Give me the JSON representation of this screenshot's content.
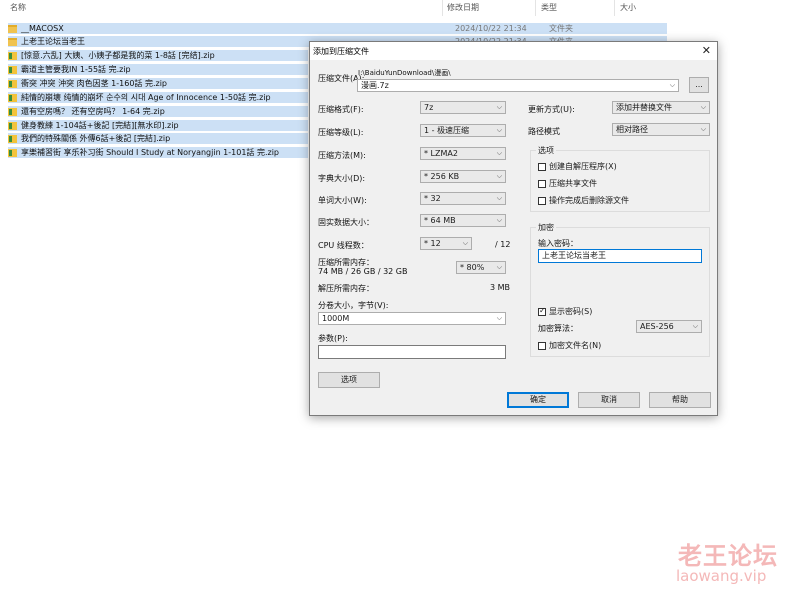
{
  "explorer": {
    "columns": {
      "name": "名称",
      "modified": "修改日期",
      "type": "类型",
      "size": "大小"
    },
    "rows": [
      {
        "name": "__MACOSX",
        "date": "2024/10/22 21:34",
        "type": "文件夹",
        "icon": "folder"
      },
      {
        "name": "上老王论坛当老王",
        "date": "2024/10/22 21:34",
        "type": "文件夹",
        "icon": "folder"
      },
      {
        "name": "[惊意.六乱] 大姨、小姨子都是我的菜 1-8話 [完结].zip",
        "icon": "zip"
      },
      {
        "name": "霸道主管要我IN 1-55話 完.zip",
        "icon": "zip"
      },
      {
        "name": "衝突 冲突 沖突 肉色因茎 1-160話 完.zip",
        "icon": "zip"
      },
      {
        "name": "純情的崩壊 纯情的崩坏 순수의 시대 Age of Innocence 1-50話 完.zip",
        "icon": "zip"
      },
      {
        "name": "還有空房嗎？ 还有空房吗？ 1-64 完.zip",
        "icon": "zip"
      },
      {
        "name": "健身教練 1-104話+後記 [完結][無水印].zip",
        "icon": "zip"
      },
      {
        "name": "我們的特殊關係 外傳6話+後記 [完結].zip",
        "icon": "zip"
      },
      {
        "name": "享樂補習街 享乐补习街 Should I Study at Noryangjin 1-101話 完.zip",
        "icon": "zip"
      }
    ]
  },
  "dialog": {
    "title": "添加到压缩文件",
    "close": "✕",
    "archive_label": "压缩文件(A):",
    "archive_path": "I:\\BaiduYunDownload\\漫画\\",
    "archive_name": "漫画.7z",
    "browse": "...",
    "format_label": "压缩格式(F):",
    "format_value": "7z",
    "level_label": "压缩等级(L):",
    "level_value": "1 - 极速压缩",
    "method_label": "压缩方法(M):",
    "method_value": "* LZMA2",
    "dict_label": "字典大小(D):",
    "dict_value": "* 256 KB",
    "word_label": "单词大小(W):",
    "word_value": "* 32",
    "solid_label": "固实数据大小：",
    "solid_value": "* 64 MB",
    "cpu_label": "CPU 线程数：",
    "cpu_value": "* 12",
    "cpu_max": "/ 12",
    "memc_label": "压缩所需内存：",
    "memc_detail": "74 MB / 26 GB / 32 GB",
    "memc_percent": "* 80%",
    "memd_label": "解压所需内存：",
    "memd_value": "3 MB",
    "split_label": "分卷大小，字节(V):",
    "split_value": "1000M",
    "params_label": "参数(P):",
    "params_value": "",
    "options_button": "选项",
    "update_label": "更新方式(U):",
    "update_value": "添加并替换文件",
    "path_label": "路径模式",
    "path_value": "相对路径",
    "options_group": "选项",
    "opt_sfx": "创建自解压程序(X)",
    "opt_shared": "压缩共享文件",
    "opt_delete": "操作完成后删除源文件",
    "enc_group": "加密",
    "enc_pwd_label": "输入密码：",
    "enc_pwd_value": "上老王论坛当老王",
    "enc_show": "显示密码(S)",
    "enc_method_label": "加密算法：",
    "enc_method_value": "AES-256",
    "enc_names": "加密文件名(N)",
    "ok": "确定",
    "cancel": "取消",
    "help": "帮助"
  },
  "watermark": {
    "line1": "老王论坛",
    "line2": "laowang.vip"
  }
}
